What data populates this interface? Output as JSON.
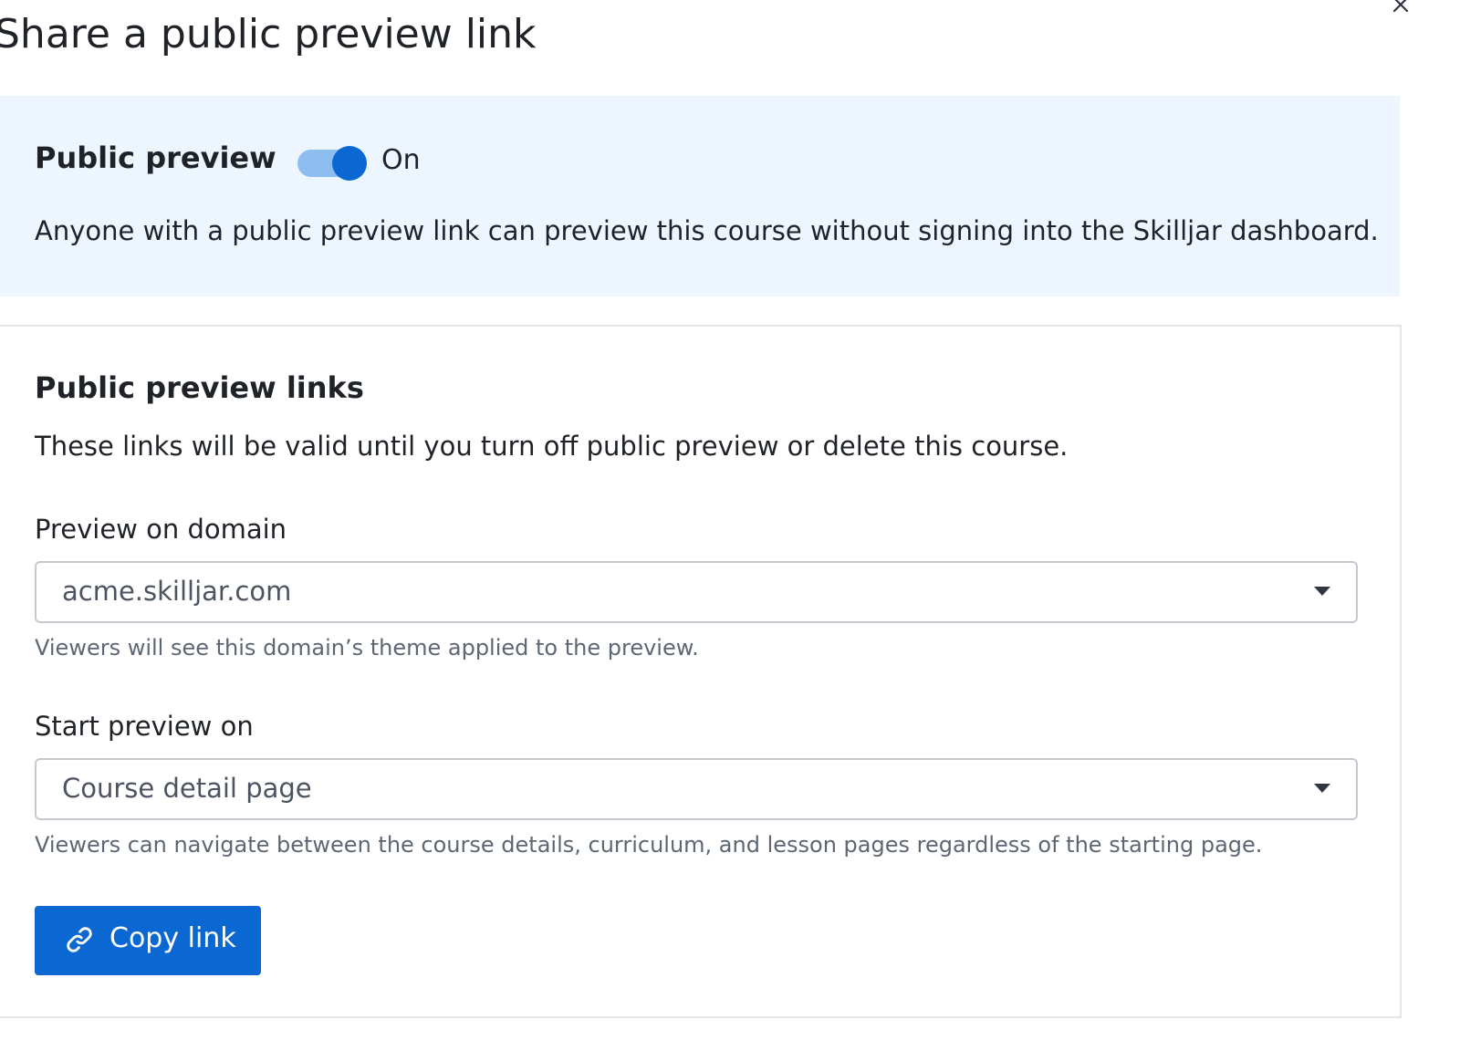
{
  "dialog": {
    "title": "Share a public preview link",
    "close_icon": "close-icon"
  },
  "public_preview": {
    "heading": "Public preview",
    "toggle_on": true,
    "toggle_state_label": "On",
    "description": "Anyone with a public preview link can preview this course without signing into the Skilljar dashboard.",
    "panel_color": "#edf5fe",
    "toggle_color": "#0b67d1"
  },
  "links": {
    "heading": "Public preview links",
    "description": "These links will be valid until you turn off public preview or delete this course.",
    "domain": {
      "label": "Preview on domain",
      "value": "acme.skilljar.com",
      "helper": "Viewers will see this domain’s theme applied to the preview."
    },
    "start_page": {
      "label": "Start preview on",
      "value": "Course detail page",
      "helper": "Viewers can navigate between the course details, curriculum, and lesson pages regardless of the starting page."
    },
    "copy_button": {
      "label": "Copy link",
      "icon": "link-icon",
      "color": "#0b67d1"
    }
  }
}
